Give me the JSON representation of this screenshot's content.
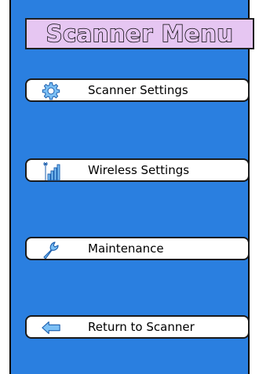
{
  "title": "Scanner Menu",
  "menu": {
    "items": [
      {
        "label": "Scanner Settings",
        "icon": "gear-icon"
      },
      {
        "label": "Wireless Settings",
        "icon": "wireless-signal-icon"
      },
      {
        "label": "Maintenance",
        "icon": "wrench-icon"
      },
      {
        "label": "Return to Scanner",
        "icon": "back-arrow-icon"
      }
    ]
  },
  "colors": {
    "background": "#2a7fe0",
    "title_bar": "#e6c6f2",
    "button": "#ffffff",
    "icon": "#5aaaf0"
  }
}
